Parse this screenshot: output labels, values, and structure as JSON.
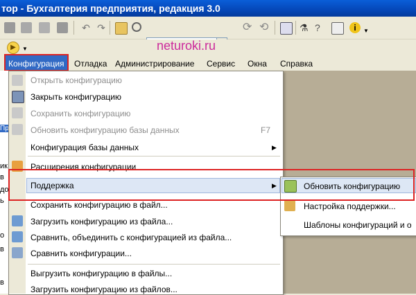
{
  "window": {
    "title": "тор - Бухгалтерия предприятия, редакция 3.0"
  },
  "watermark": "neturoki.ru",
  "search": {
    "value": "",
    "clear_label": "x"
  },
  "menubar": {
    "items": [
      {
        "label": "Конфигурация"
      },
      {
        "label": "Отладка"
      },
      {
        "label": "Администрирование"
      },
      {
        "label": "Сервис"
      },
      {
        "label": "Окна"
      },
      {
        "label": "Справка"
      }
    ]
  },
  "config_menu": {
    "items": [
      {
        "label": "Открыть конфигурацию",
        "disabled": true,
        "icon": "open-config-icon"
      },
      {
        "label": "Закрыть конфигурацию",
        "disabled": false,
        "icon": "close-config-icon"
      },
      {
        "label": "Сохранить конфигурацию",
        "disabled": true,
        "icon": "save-config-icon"
      },
      {
        "label": "Обновить конфигурацию базы данных",
        "disabled": true,
        "shortcut": "F7",
        "icon": "update-db-icon"
      },
      {
        "label": "Конфигурация базы данных",
        "disabled": false,
        "submenu": true
      },
      {
        "label": "Расширения конфигурации",
        "disabled": false,
        "icon": "extensions-icon"
      },
      {
        "label": "Поддержка",
        "disabled": false,
        "submenu": true,
        "highlighted": true
      },
      {
        "label": "Сохранить конфигурацию в файл...",
        "disabled": false
      },
      {
        "label": "Загрузить конфигурацию из файла...",
        "disabled": false,
        "icon": "load-from-file-icon"
      },
      {
        "label": "Сравнить, объединить с конфигурацией из файла...",
        "disabled": false,
        "icon": "compare-merge-icon"
      },
      {
        "label": "Сравнить конфигурации...",
        "disabled": false,
        "icon": "compare-icon"
      },
      {
        "label": "Выгрузить конфигурацию в файлы...",
        "disabled": false
      },
      {
        "label": "Загрузить конфигурацию из файлов...",
        "disabled": false
      }
    ]
  },
  "support_submenu": {
    "items": [
      {
        "label": "Обновить конфигурацию",
        "icon": "update-config-icon",
        "highlighted": true
      },
      {
        "label": "Настройка поддержки...",
        "icon": "support-settings-icon"
      },
      {
        "label": "Шаблоны конфигураций и о"
      }
    ]
  },
  "left_fragments": [
    "ик",
    "в",
    "до",
    "ь",
    "",
    "о",
    "в",
    "в"
  ],
  "colors": {
    "title_bar": "#0547b8",
    "highlight": "#dde7f5",
    "annotation_red": "#dd2222",
    "watermark": "#cc2b9c"
  }
}
